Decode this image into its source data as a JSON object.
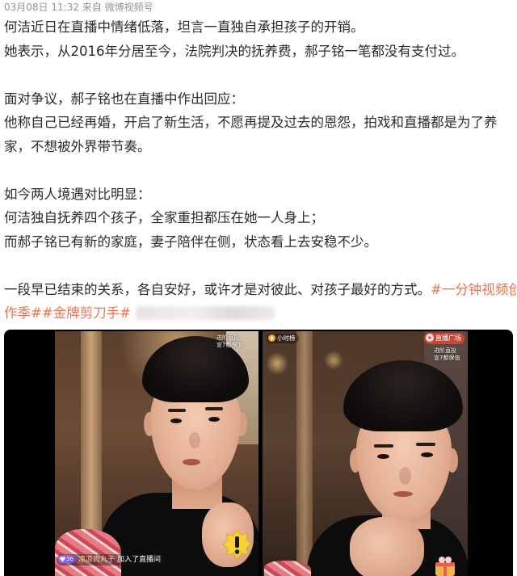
{
  "post": {
    "date": "03月08日",
    "time": "11:32",
    "source_prefix": "来自",
    "source": "微博视频号",
    "paragraphs": [
      [
        "何洁近日在直播中情绪低落，坦言一直独自承担孩子的开销。",
        "她表示，从2016年分居至今，法院判决的抚养费，郝子铭一笔都没有支付过。"
      ],
      [
        "面对争议，郝子铭也在直播中作出回应：",
        "他称自己已经再婚，开启了新生活，不愿再提及过去的恩怨，拍戏和直播都是为了养",
        "家，不想被外界带节奏。"
      ],
      [
        "如今两人境遇对比明显：",
        "何洁独自抚养四个孩子，全家重担都压在她一人身上；",
        "而郝子铭已有新的家庭，妻子陪伴在侧，状态看上去安稳不少。"
      ]
    ],
    "closing": {
      "text": "一段早已结束的关系，各自安好，或许才是对彼此、对孩子最好的方式。",
      "hashtag_1_part_1": "#一分钟视频创",
      "hashtag_1_part_2": "作季#",
      "hashtag_2": "#金牌剪刀手#"
    }
  },
  "video": {
    "left_frame": {
      "corner_text": [
        "进阶直投",
        "宣7都保值"
      ],
      "join_notice": {
        "level": "36",
        "username": "凉凉肉丸子",
        "action": "加入了直播间"
      }
    },
    "right_frame": {
      "rank_label": "小时榜",
      "plaza_label": "直播广场",
      "corner_text": [
        "进阶直投",
        "宣7都保值"
      ]
    }
  },
  "icons": {
    "join_badge": "heart-icon",
    "rank": "trophy-icon",
    "plaza": "live-icon",
    "left_sticker": "alert-sticker-icon",
    "right_sticker": "gift-sticker-icon"
  },
  "colors": {
    "text": "#2b2b2b",
    "meta": "#939393",
    "hashtag": "#eb7350",
    "video_background": "#000000"
  }
}
